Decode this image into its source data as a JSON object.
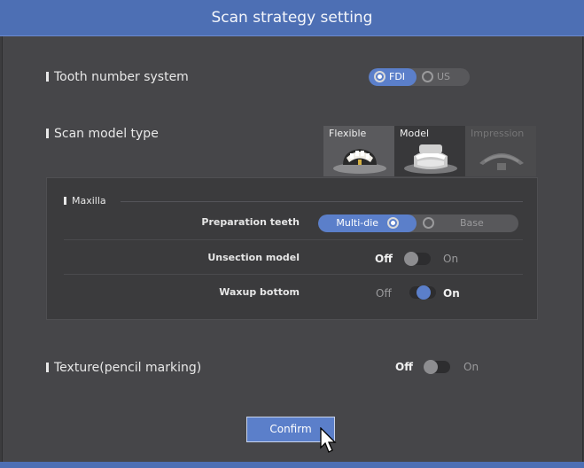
{
  "title": "Scan strategy setting",
  "tooth_system": {
    "label": "Tooth number system",
    "options": [
      "FDI",
      "US"
    ],
    "selected": "FDI"
  },
  "model_type": {
    "label": "Scan model type",
    "cards": [
      {
        "label": "Flexible",
        "state": "normal"
      },
      {
        "label": "Model",
        "state": "selected"
      },
      {
        "label": "Impression",
        "state": "disabled"
      }
    ]
  },
  "maxilla": {
    "heading": "Maxilla",
    "preparation": {
      "label": "Preparation teeth",
      "options": [
        "Multi-die",
        "Base"
      ],
      "selected": "Multi-die"
    },
    "unsection": {
      "label": "Unsection model",
      "off": "Off",
      "on": "On",
      "value": "Off"
    },
    "waxup": {
      "label": "Waxup bottom",
      "off": "Off",
      "on": "On",
      "value": "On"
    }
  },
  "texture": {
    "label": "Texture(pencil marking)",
    "off": "Off",
    "on": "On",
    "value": "Off"
  },
  "confirm_label": "Confirm",
  "colors": {
    "accent": "#5b7fca",
    "title_bar": "#4d6fb4",
    "background": "#464649"
  }
}
